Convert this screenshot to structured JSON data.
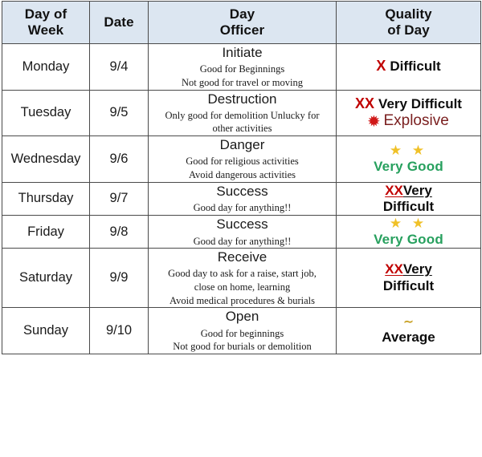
{
  "table": {
    "headers": [
      {
        "line1": "Day of",
        "line2": "Week"
      },
      {
        "line1": "Date",
        "line2": ""
      },
      {
        "line1": "Day",
        "line2": "Officer"
      },
      {
        "line1": "Quality",
        "line2": "of Day"
      }
    ],
    "rows": [
      {
        "day_of_week": "Monday",
        "date": "9/4",
        "officer": "Initiate",
        "description": [
          "Good for Beginnings",
          "Not good for travel or moving"
        ],
        "quality": {
          "style": "x-difficult",
          "mark": "X",
          "label": "Difficult"
        }
      },
      {
        "day_of_week": "Tuesday",
        "date": "9/5",
        "officer": "Destruction",
        "description": [
          "Only good for demolition Unlucky for",
          "other activities"
        ],
        "quality": {
          "style": "xx-very-difficult-explosive",
          "mark": "XX",
          "label": "Very Difficult",
          "burst_icon": "✹",
          "secondary_label": "Explosive"
        }
      },
      {
        "day_of_week": "Wednesday",
        "date": "9/6",
        "officer": "Danger",
        "description": [
          "Good for religious activities",
          "Avoid dangerous activities"
        ],
        "quality": {
          "style": "stars-very-good",
          "stars": "★ ★",
          "label": "Very Good"
        }
      },
      {
        "day_of_week": "Thursday",
        "date": "9/7",
        "officer": "Success",
        "description": [
          "Good day for anything!!"
        ],
        "quality": {
          "style": "xx-very-underline-difficult",
          "mark": "XX",
          "label_line1": "Very",
          "label_line2": "Difficult"
        }
      },
      {
        "day_of_week": "Friday",
        "date": "9/8",
        "officer": "Success",
        "description": [
          "Good day for anything!!"
        ],
        "quality": {
          "style": "stars-very-good",
          "stars": "★ ★",
          "label": "Very Good"
        }
      },
      {
        "day_of_week": "Saturday",
        "date": "9/9",
        "officer": "Receive",
        "description": [
          "Good day to ask for a raise, start job,",
          "close on home, learning",
          "Avoid medical procedures & burials"
        ],
        "quality": {
          "style": "xx-very-underline-difficult",
          "mark": "XX",
          "label_line1": "Very",
          "label_line2": "Difficult"
        }
      },
      {
        "day_of_week": "Sunday",
        "date": "9/10",
        "officer": "Open",
        "description": [
          "Good for beginnings",
          "Not good for burials or demolition"
        ],
        "quality": {
          "style": "tilde-average",
          "tilde": "∼",
          "label": "Average"
        }
      }
    ]
  },
  "colors": {
    "header_background": "#dce6f1",
    "border": "#4a4a4a",
    "red_mark": "#c00000",
    "explosive_text": "#7b2020",
    "burst_icon": "#d01818",
    "green_good": "#27a05e",
    "star_gold": "#f0c128",
    "tilde_gold": "#c9a227",
    "text_black": "#0d0d0d"
  }
}
